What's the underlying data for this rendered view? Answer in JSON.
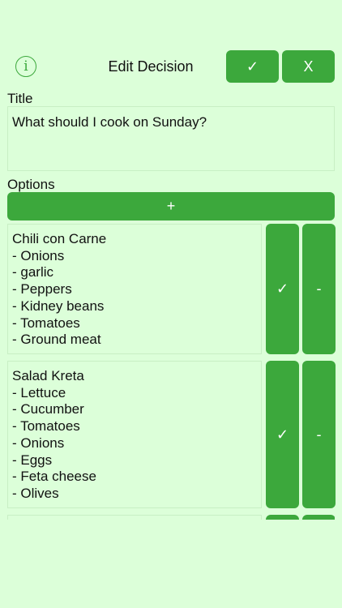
{
  "header": {
    "info_icon": "info-icon",
    "title": "Edit Decision",
    "confirm_label": "✓",
    "cancel_label": "X"
  },
  "title_section": {
    "label": "Title",
    "value": "What should I cook on Sunday?"
  },
  "options_section": {
    "label": "Options",
    "add_label": "+",
    "items": [
      {
        "text": "Chili con Carne\n- Onions\n- garlic\n- Peppers\n- Kidney beans\n- Tomatoes\n- Ground meat",
        "select_label": "✓",
        "remove_label": "-"
      },
      {
        "text": "Salad Kreta\n- Lettuce\n- Cucumber\n- Tomatoes\n- Onions\n- Eggs\n- Feta cheese\n- Olives",
        "select_label": "✓",
        "remove_label": "-"
      }
    ]
  },
  "colors": {
    "background": "#dcffd9",
    "accent": "#3ca83c",
    "border": "#c8efc4"
  }
}
